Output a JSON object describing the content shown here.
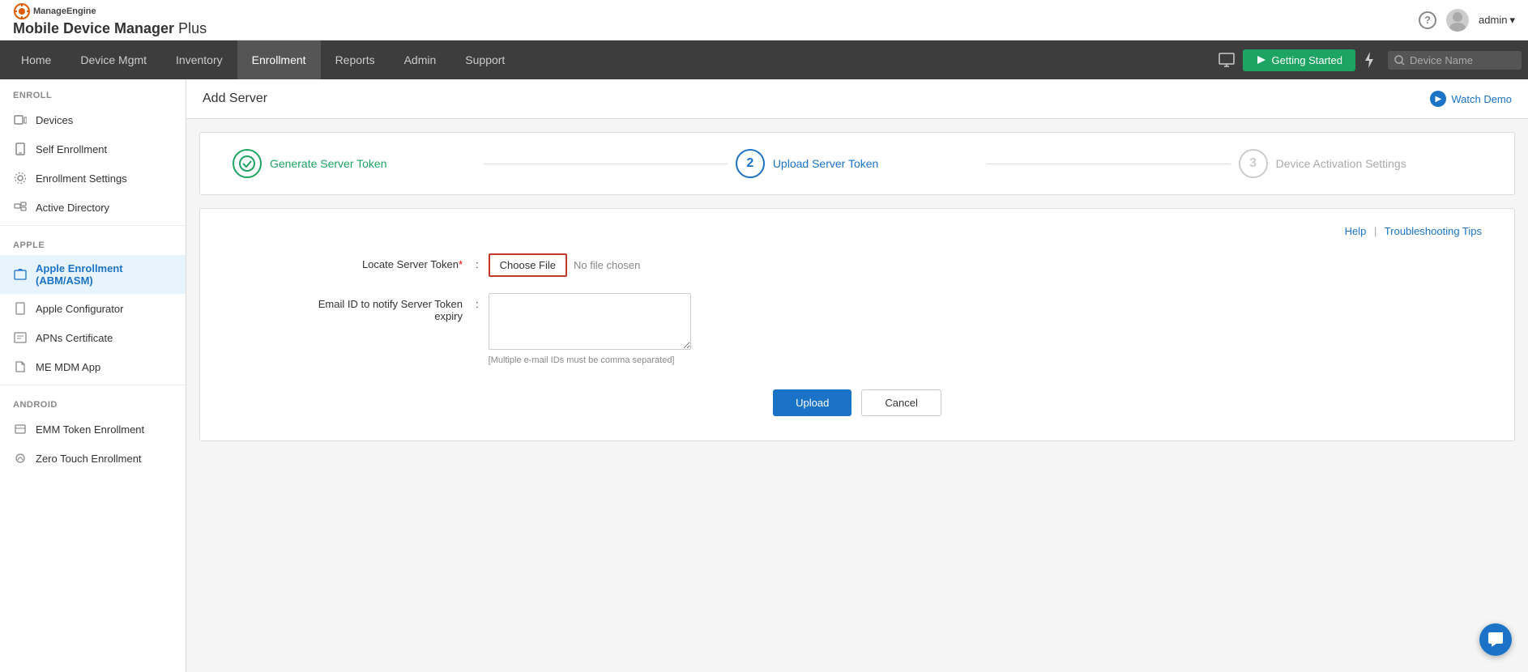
{
  "app": {
    "brand": "ManageEngine",
    "title": "Mobile Device Manager Plus"
  },
  "header": {
    "help_label": "?",
    "admin_label": "admin",
    "admin_caret": "▾"
  },
  "nav": {
    "items": [
      {
        "id": "home",
        "label": "Home",
        "active": false
      },
      {
        "id": "device-mgmt",
        "label": "Device Mgmt",
        "active": false
      },
      {
        "id": "inventory",
        "label": "Inventory",
        "active": false
      },
      {
        "id": "enrollment",
        "label": "Enrollment",
        "active": true
      },
      {
        "id": "reports",
        "label": "Reports",
        "active": false
      },
      {
        "id": "admin",
        "label": "Admin",
        "active": false
      },
      {
        "id": "support",
        "label": "Support",
        "active": false
      }
    ],
    "getting_started": "Getting Started",
    "search_placeholder": "Device Name"
  },
  "sidebar": {
    "enroll_section": "Enroll",
    "items_enroll": [
      {
        "id": "devices",
        "label": "Devices"
      },
      {
        "id": "self-enrollment",
        "label": "Self Enrollment"
      },
      {
        "id": "enrollment-settings",
        "label": "Enrollment Settings"
      },
      {
        "id": "active-directory",
        "label": "Active Directory"
      }
    ],
    "apple_section": "Apple",
    "items_apple": [
      {
        "id": "apple-enrollment",
        "label": "Apple Enrollment (ABM/ASM)",
        "active": true
      },
      {
        "id": "apple-configurator",
        "label": "Apple Configurator"
      },
      {
        "id": "apns-certificate",
        "label": "APNs Certificate"
      },
      {
        "id": "me-mdm-app",
        "label": "ME MDM App"
      }
    ],
    "android_section": "Android",
    "items_android": [
      {
        "id": "emm-token",
        "label": "EMM Token Enrollment"
      },
      {
        "id": "zero-touch",
        "label": "Zero Touch Enrollment"
      }
    ]
  },
  "page": {
    "title": "Add Server",
    "watch_demo": "Watch Demo"
  },
  "wizard": {
    "step1_label": "Generate Server Token",
    "step1_status": "done",
    "step2_label": "Upload Server Token",
    "step2_status": "active",
    "step2_number": "2",
    "step3_label": "Device Activation Settings",
    "step3_status": "inactive",
    "step3_number": "3"
  },
  "form": {
    "help_link": "Help",
    "pipe": "|",
    "troubleshooting_link": "Troubleshooting Tips",
    "locate_label": "Locate Server Token",
    "required_marker": "*",
    "choose_file_btn": "Choose File",
    "no_file_text": "No file chosen",
    "email_label": "Email ID to notify Server Token expiry",
    "email_hint": "[Multiple e-mail IDs must be comma separated]",
    "upload_btn": "Upload",
    "cancel_btn": "Cancel"
  },
  "chat": {
    "icon": "💬"
  }
}
